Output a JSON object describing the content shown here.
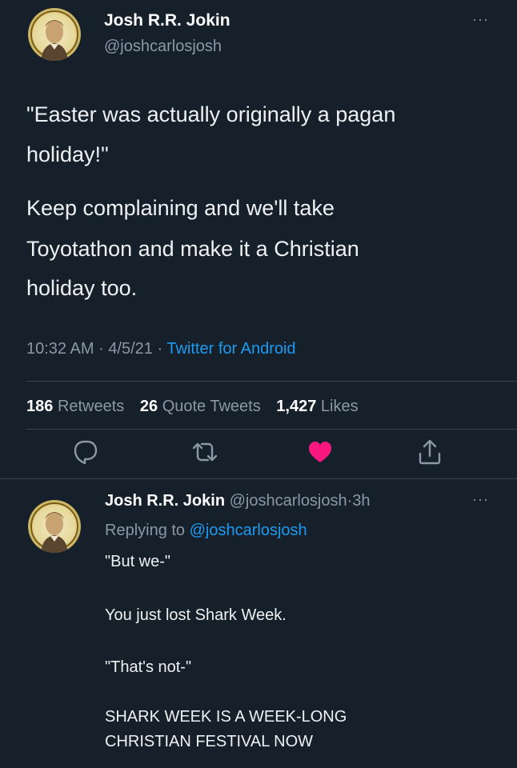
{
  "tweet": {
    "author_name": "Josh R.R. Jokin",
    "author_handle": "@joshcarlosjosh",
    "more_icon": "more-horizontal-icon",
    "text_line_1": "\"Easter was actually originally a pagan",
    "text_line_2": "holiday!\"",
    "text_line_3": "Keep complaining and we'll take",
    "text_line_4": "Toyotathon and make it a Christian",
    "text_line_5": "holiday too.",
    "time": "10:32 AM",
    "date": "4/5/21",
    "source": "Twitter for Android",
    "separator": "·"
  },
  "stats": {
    "retweets_count": "186",
    "retweets_label": "Retweets",
    "quotes_count": "26",
    "quotes_label": "Quote Tweets",
    "likes_count": "1,427",
    "likes_label": "Likes"
  },
  "actions": {
    "reply_icon": "reply-icon",
    "retweet_icon": "retweet-icon",
    "like_icon": "heart-icon",
    "share_icon": "share-icon",
    "liked": true,
    "like_color": "#f91880"
  },
  "reply": {
    "author_name": "Josh R.R. Jokin",
    "author_handle": "@joshcarlosjosh",
    "separator": "·",
    "age": "3h",
    "replying_prefix": "Replying to",
    "replying_handle": "@joshcarlosjosh",
    "lines": [
      "\"But we-\"",
      "You just lost Shark Week.",
      "\"That's not-\"",
      "SHARK WEEK IS A WEEK-LONG",
      "CHRISTIAN FESTIVAL NOW"
    ]
  },
  "colors": {
    "background": "#15202b",
    "accent": "#1d9bf0",
    "secondary_text": "#8b98a5"
  }
}
